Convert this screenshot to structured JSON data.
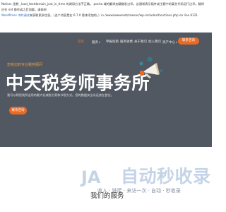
{
  "notice": {
    "line1_label": "Notice",
    "line1_text": ": 函数 _load_textdomain_just_in_time 的调用方法不正确。 ",
    "line1_rest": "pecha 域的翻译加载触发过早。这通常表示插件或主题中的某些代码运行过早。翻译应在 init 操作或之后加载。请查阅",
    "line2_link": "WordPress 中的调试",
    "line2_text": "来获取更多信息。（这个消息是在 6.7.0 版本添加的。）in ",
    "line2_path": "/www/wwwroot/zswsoc/wp-includes/functions.php",
    "line2_tail": " on line 6121"
  },
  "nav": {
    "items": [
      {
        "label": "首页",
        "active": true,
        "caret": false
      },
      {
        "label": "服务",
        "active": false,
        "caret": true
      },
      {
        "label": "申报指南",
        "active": false,
        "caret": false
      },
      {
        "label": "服务收费",
        "active": false,
        "caret": false
      },
      {
        "label": "关于我们",
        "active": false,
        "caret": false
      },
      {
        "label": "加入我们",
        "active": false,
        "caret": false
      },
      {
        "label": "资产中心",
        "active": false,
        "caret": true
      }
    ],
    "caret_glyph": "▾",
    "cta_label": "联系咨询"
  },
  "hero": {
    "tagline": "您身边的专业税务顾问",
    "title": "中天税务师事务所",
    "description": "我可以帮您找到适用的最大化减税方案和节税方式。您的数据安全永远放在首位。",
    "cta_label": "联系咨询"
  },
  "watermark": {
    "logo_text": "JA",
    "text": "自动秒收录",
    "subtext": "收入 · 链接 · 来访一次 · 自动 · 秒收录"
  },
  "section": {
    "title": "我们的服务"
  },
  "colors": {
    "hero_bg": "#525862",
    "accent": "#ea6a22",
    "tagline": "#f0a23c",
    "watermark": "#c4d4e6"
  }
}
